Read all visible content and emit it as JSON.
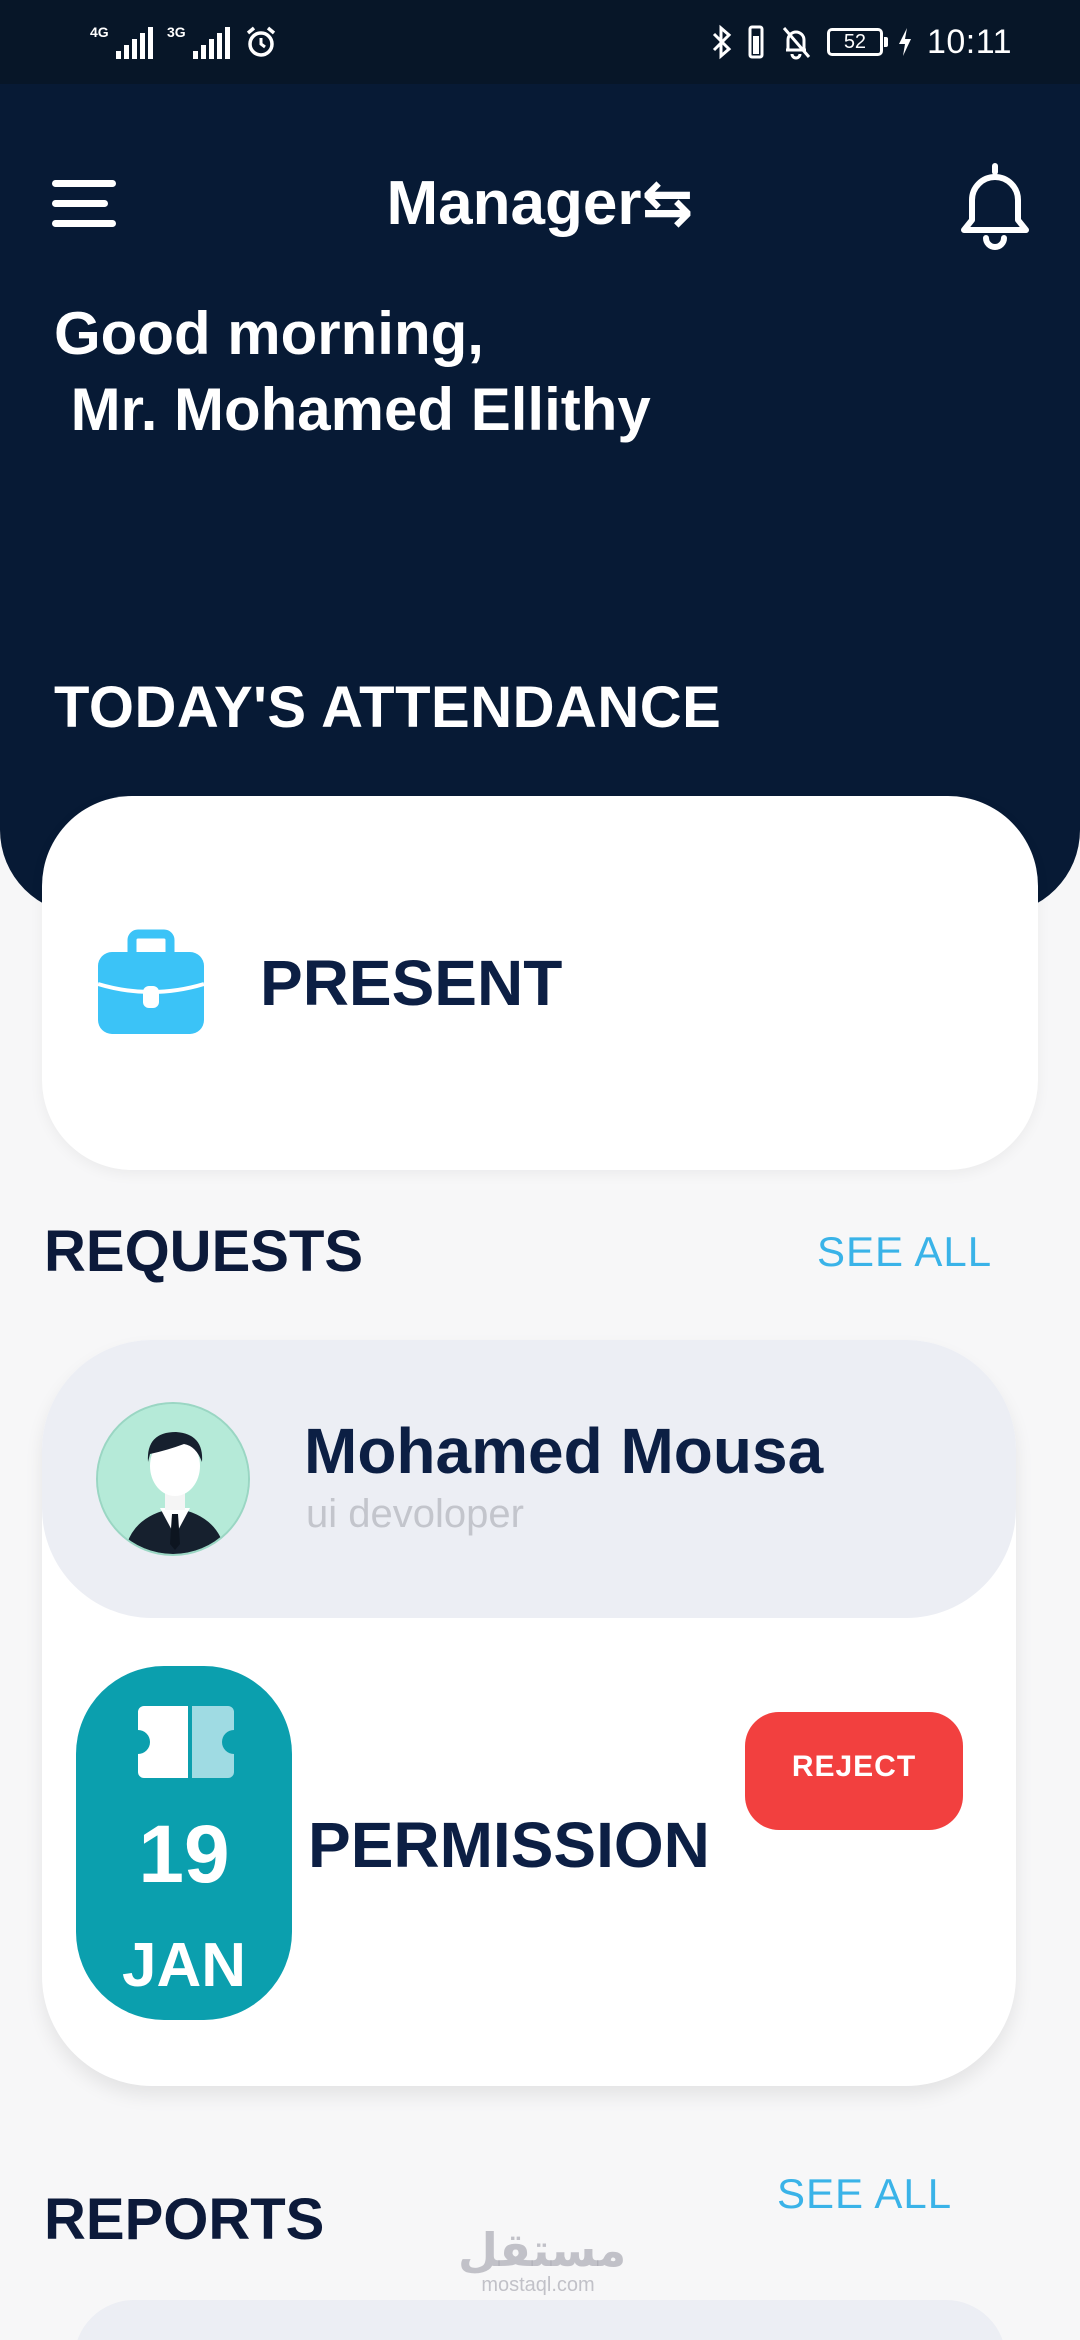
{
  "status_bar": {
    "network_1": "4G",
    "network_2": "3G",
    "battery_level": "52",
    "time": "10:11",
    "icons": [
      "signal-icon",
      "signal-icon",
      "alarm-icon",
      "bluetooth-icon",
      "vibrate-icon",
      "mute-icon",
      "battery-icon",
      "charging-icon"
    ]
  },
  "header": {
    "app_title": "Manager",
    "switch_icon": "⇆",
    "greeting": "Good morning,\n Mr. Mohamed Ellithy",
    "menu_icon": "menu-icon",
    "notification_icon": "bell-icon"
  },
  "attendance": {
    "section_title": "TODAY'S ATTENDANCE",
    "status": "PRESENT",
    "icon": "briefcase-icon"
  },
  "requests": {
    "section_title": "REQUESTS",
    "see_all_label": "SEE ALL",
    "items": [
      {
        "name": "Mohamed Mousa",
        "role": "ui devoloper",
        "day": "19",
        "month": "JAN",
        "type": "PERMISSION",
        "action_label": "REJECT"
      }
    ]
  },
  "reports": {
    "section_title": "REPORTS",
    "see_all_label": "SEE ALL"
  },
  "watermark": {
    "arabic": "مستقل",
    "latin": "mostaql.com"
  },
  "colors": {
    "header_bg": "#071a35",
    "accent_blue": "#3ab3e8",
    "teal": "#0b9fae",
    "reject_red": "#f2403f",
    "dark_text": "#0c1f44"
  }
}
